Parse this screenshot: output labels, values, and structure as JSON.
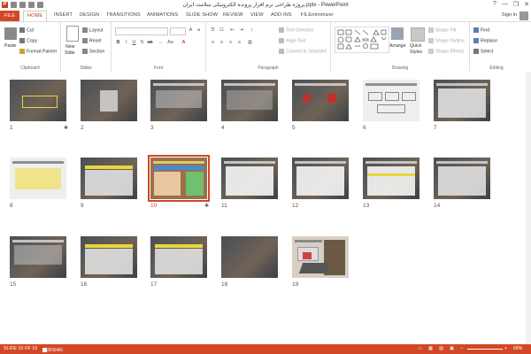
{
  "window": {
    "title": "پروژه طراحی نرم افزار پرونده الکترونیکی سلامت ایران.pptx - PowerPoint",
    "help": "?",
    "minimize": "—",
    "restore": "❐",
    "close": "✕",
    "signin": "Sign in"
  },
  "qat": {
    "app_badge": "P"
  },
  "tabs": [
    "FILE",
    "HOME",
    "INSERT",
    "DESIGN",
    "TRANSITIONS",
    "ANIMATIONS",
    "SLIDE SHOW",
    "REVIEW",
    "VIEW",
    "ADD-INS",
    "FILEminimizer"
  ],
  "ribbon": {
    "clipboard": {
      "label": "Clipboard",
      "paste": "Paste",
      "cut": "Cut",
      "copy": "Copy",
      "format_painter": "Format Painter"
    },
    "slides": {
      "label": "Slides",
      "new_slide": "New",
      "new_slide2": "Slide",
      "layout": "Layout",
      "reset": "Reset",
      "section": "Section"
    },
    "font": {
      "label": "Font"
    },
    "paragraph": {
      "label": "Paragraph",
      "text_direction": "Text Direction",
      "align_text": "Align Text",
      "convert": "Convert to SmartArt"
    },
    "drawing": {
      "label": "Drawing",
      "arrange": "Arrange",
      "quick": "Quick",
      "styles": "Styles",
      "shape_fill": "Shape Fill",
      "shape_outline": "Shape Outline",
      "shape_effects": "Shape Effects"
    },
    "editing": {
      "label": "Editing",
      "find": "Find",
      "replace": "Replace",
      "select": "Select"
    }
  },
  "slides": [
    {
      "num": "1",
      "star": "✱"
    },
    {
      "num": "2"
    },
    {
      "num": "3"
    },
    {
      "num": "4"
    },
    {
      "num": "5"
    },
    {
      "num": "6"
    },
    {
      "num": "7"
    },
    {
      "num": "8"
    },
    {
      "num": "9"
    },
    {
      "num": "10",
      "star": "✱",
      "selected": true
    },
    {
      "num": "11"
    },
    {
      "num": "12"
    },
    {
      "num": "13"
    },
    {
      "num": "14"
    },
    {
      "num": "15"
    },
    {
      "num": "16"
    },
    {
      "num": "17"
    },
    {
      "num": "18"
    },
    {
      "num": "19"
    }
  ],
  "status": {
    "slide_of": "SLIDE 10 OF 19",
    "language": "PERSIAN",
    "zoom": "68%"
  },
  "colors": {
    "accent": "#d24726"
  }
}
